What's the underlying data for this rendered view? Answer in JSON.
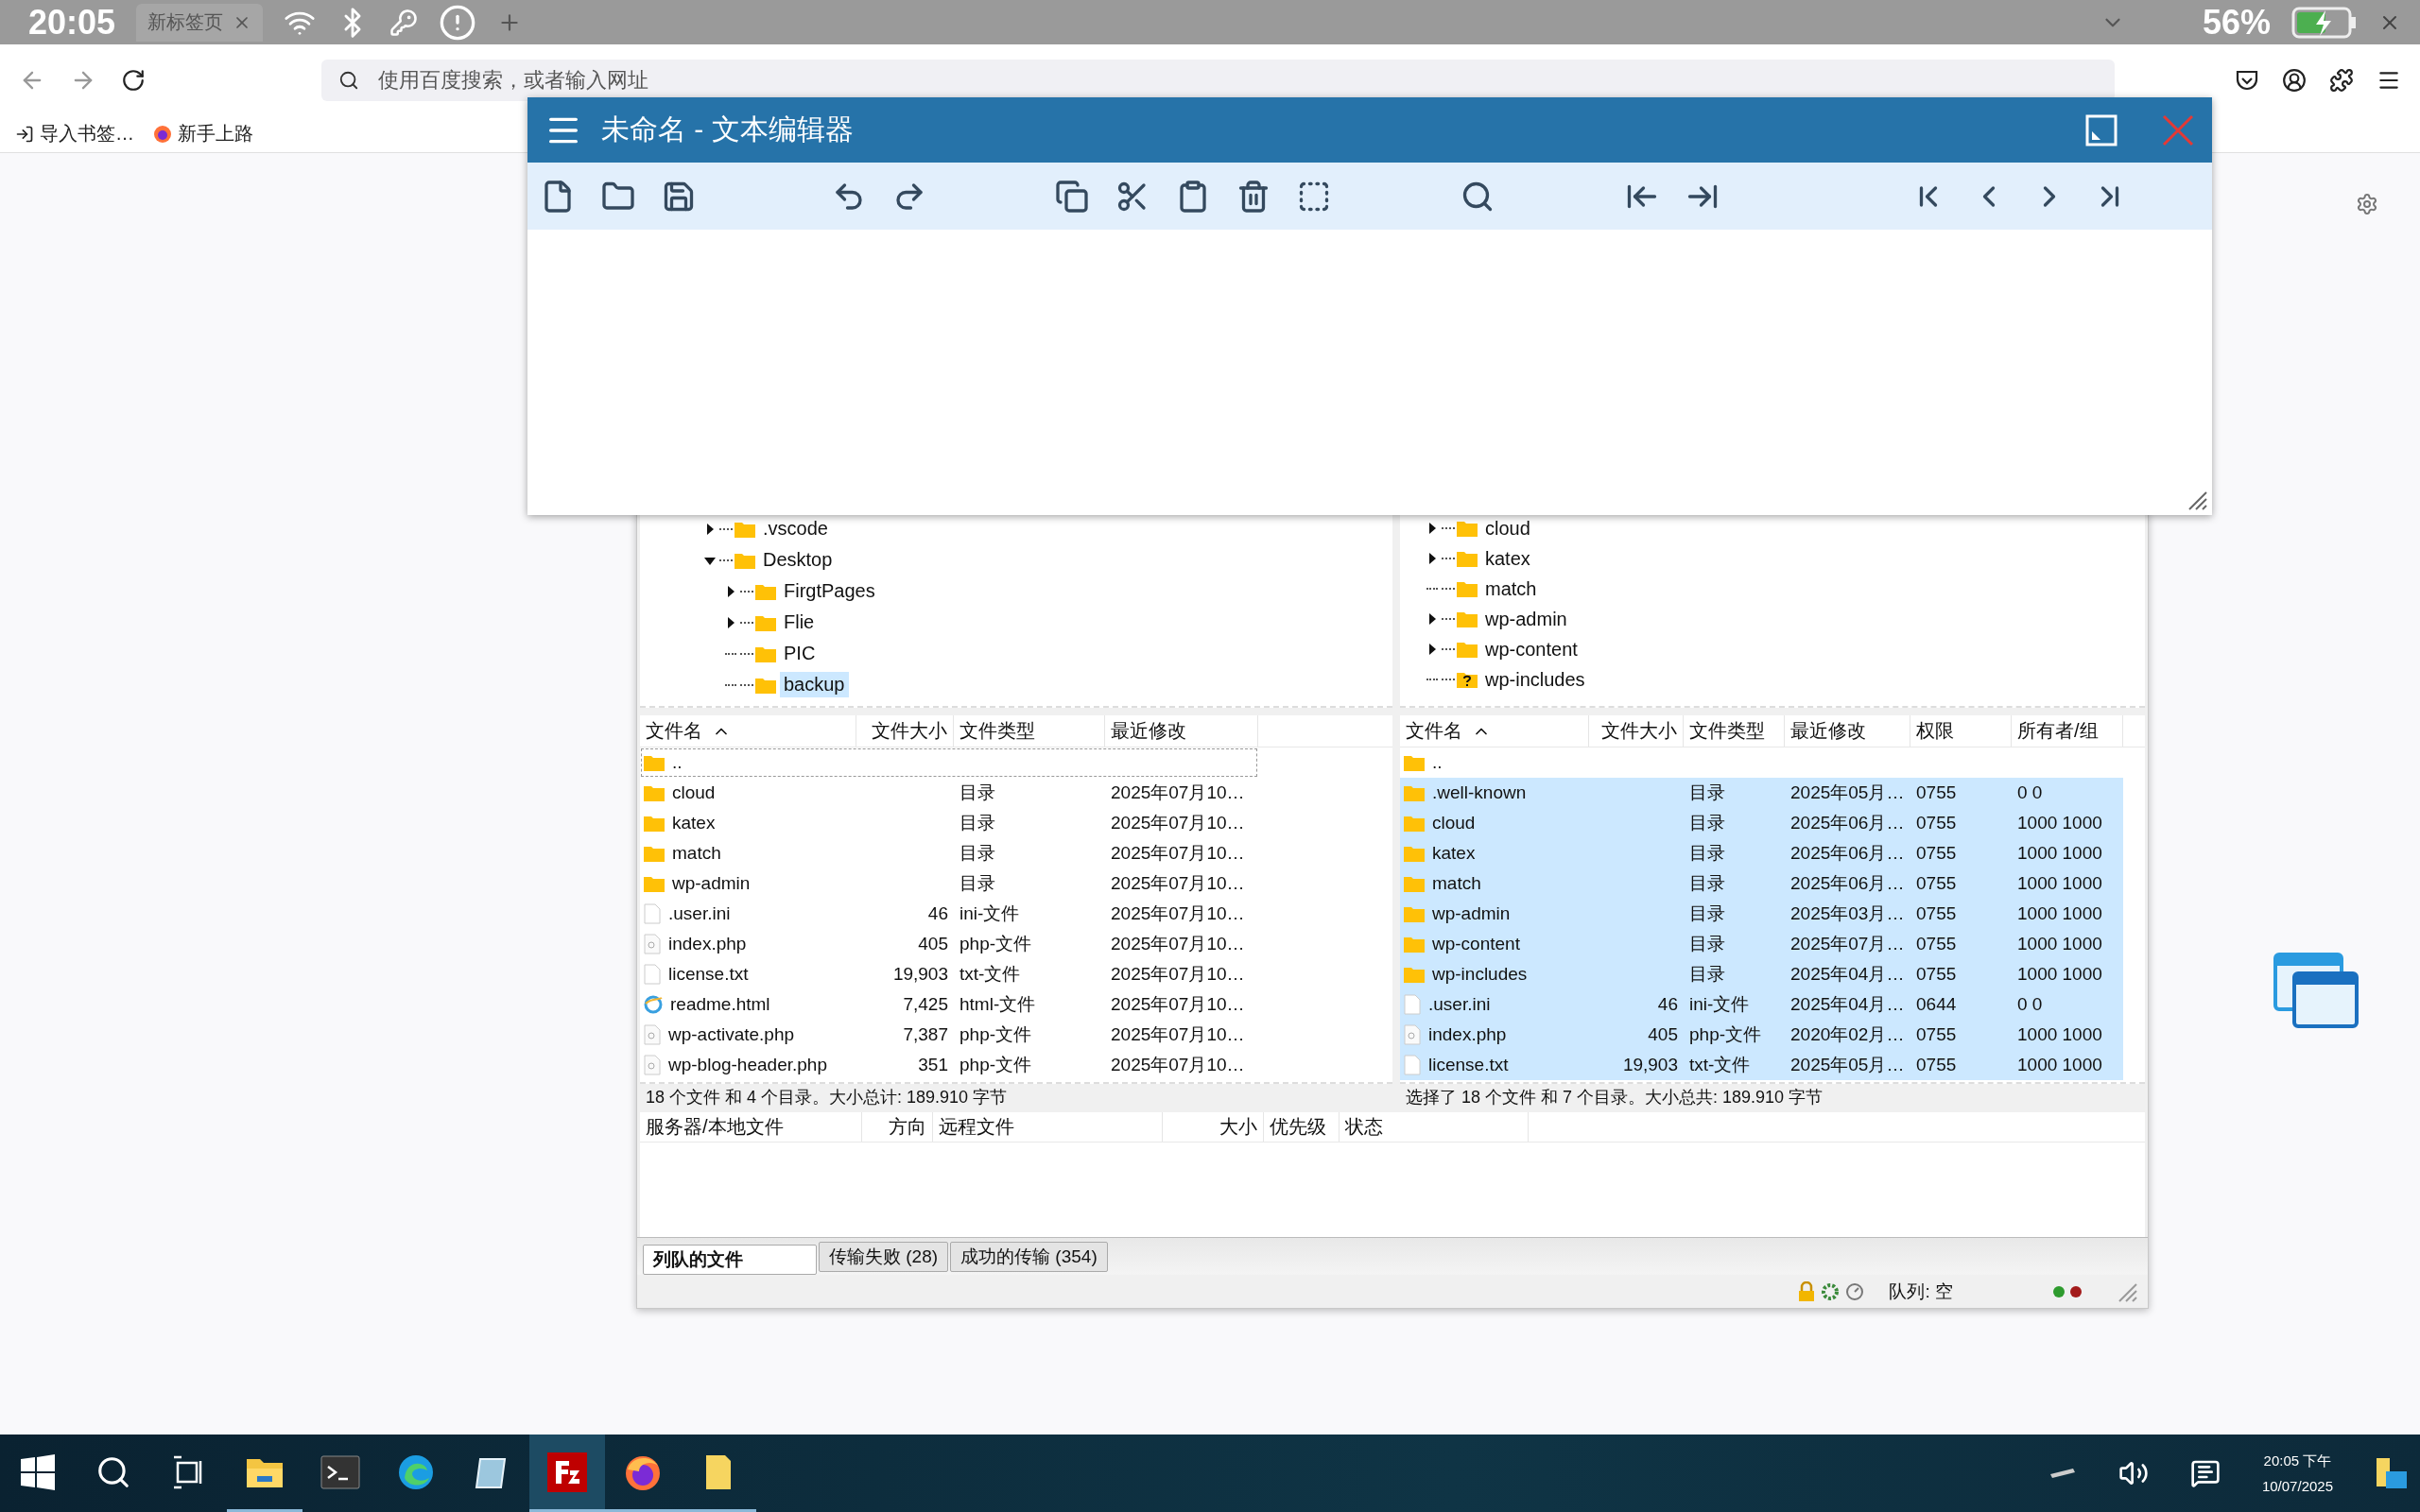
{
  "system_bar": {
    "time": "20:05",
    "battery": "56%"
  },
  "browser": {
    "tab": {
      "title": "新标签页"
    },
    "address": {
      "placeholder": "使用百度搜索，或者输入网址"
    },
    "bookmarks": [
      {
        "kind": "import",
        "label": "导入书签…"
      },
      {
        "kind": "firefox",
        "label": "新手上路"
      }
    ]
  },
  "editor": {
    "title": "未命名 - 文本编辑器"
  },
  "filezilla": {
    "local_tree": [
      {
        "label": ".vscode",
        "kind": "branch",
        "expanded": false,
        "selected": false
      },
      {
        "label": "Desktop",
        "kind": "branch",
        "expanded": true,
        "selected": false,
        "children": [
          {
            "label": "FirgtPages",
            "kind": "branch",
            "expanded": false,
            "selected": false
          },
          {
            "label": "Flie",
            "kind": "branch",
            "expanded": false,
            "selected": false
          },
          {
            "label": "PIC",
            "kind": "leaf",
            "selected": false
          },
          {
            "label": "backup",
            "kind": "leaf",
            "selected": true
          }
        ]
      }
    ],
    "remote_tree": [
      {
        "label": "cloud",
        "kind": "branch",
        "expanded": false,
        "selected": false
      },
      {
        "label": "katex",
        "kind": "branch",
        "expanded": false,
        "selected": false
      },
      {
        "label": "match",
        "kind": "leaf",
        "selected": false
      },
      {
        "label": "wp-admin",
        "kind": "branch",
        "expanded": false,
        "selected": false
      },
      {
        "label": "wp-content",
        "kind": "branch",
        "expanded": false,
        "selected": false
      },
      {
        "label": "wp-includes",
        "kind": "unknown",
        "selected": false
      }
    ],
    "local_list": {
      "columns": [
        {
          "label": "文件名",
          "sorted": true
        },
        {
          "label": "文件大小",
          "sorted": false
        },
        {
          "label": "文件类型",
          "sorted": false
        },
        {
          "label": "最近修改",
          "sorted": false
        }
      ],
      "rows": [
        {
          "kind": "folder",
          "name": "..",
          "selected": false,
          "focused": true
        },
        {
          "kind": "folder",
          "name": "cloud",
          "type": "目录",
          "modified": "2025年07月10…",
          "selected": false,
          "focused": false
        },
        {
          "kind": "folder",
          "name": "katex",
          "type": "目录",
          "modified": "2025年07月10…",
          "selected": false,
          "focused": false
        },
        {
          "kind": "folder",
          "name": "match",
          "type": "目录",
          "modified": "2025年07月10…",
          "selected": false,
          "focused": false
        },
        {
          "kind": "folder",
          "name": "wp-admin",
          "type": "目录",
          "modified": "2025年07月10…",
          "selected": false,
          "focused": false
        },
        {
          "kind": "file",
          "name": ".user.ini",
          "size": "46",
          "type": "ini-文件",
          "modified": "2025年07月10…",
          "selected": false,
          "focused": false
        },
        {
          "kind": "script",
          "name": "index.php",
          "size": "405",
          "type": "php-文件",
          "modified": "2025年07月10…",
          "selected": false,
          "focused": false
        },
        {
          "kind": "file",
          "name": "license.txt",
          "size": "19,903",
          "type": "txt-文件",
          "modified": "2025年07月10…",
          "selected": false,
          "focused": false
        },
        {
          "kind": "web",
          "name": "readme.html",
          "size": "7,425",
          "type": "html-文件",
          "modified": "2025年07月10…",
          "selected": false,
          "focused": false
        },
        {
          "kind": "script",
          "name": "wp-activate.php",
          "size": "7,387",
          "type": "php-文件",
          "modified": "2025年07月10…",
          "selected": false,
          "focused": false
        },
        {
          "kind": "script",
          "name": "wp-blog-header.php",
          "size": "351",
          "type": "php-文件",
          "modified": "2025年07月10…",
          "selected": false,
          "focused": false
        }
      ],
      "summary": "18 个文件 和 4 个目录。大小总计: 189.910 字节"
    },
    "remote_list": {
      "columns": [
        {
          "label": "文件名",
          "sorted": true
        },
        {
          "label": "文件大小",
          "sorted": false
        },
        {
          "label": "文件类型",
          "sorted": false
        },
        {
          "label": "最近修改",
          "sorted": false
        },
        {
          "label": "权限",
          "sorted": false
        },
        {
          "label": "所有者/组",
          "sorted": false
        }
      ],
      "rows": [
        {
          "kind": "folder",
          "name": "..",
          "selected": false,
          "focused": false
        },
        {
          "kind": "folder",
          "name": ".well-known",
          "type": "目录",
          "modified": "2025年05月…",
          "permissions": "0755",
          "owner": "0 0",
          "selected": true,
          "focused": false
        },
        {
          "kind": "folder",
          "name": "cloud",
          "type": "目录",
          "modified": "2025年06月…",
          "permissions": "0755",
          "owner": "1000 1000",
          "selected": true,
          "focused": false
        },
        {
          "kind": "folder",
          "name": "katex",
          "type": "目录",
          "modified": "2025年06月…",
          "permissions": "0755",
          "owner": "1000 1000",
          "selected": true,
          "focused": false
        },
        {
          "kind": "folder",
          "name": "match",
          "type": "目录",
          "modified": "2025年06月…",
          "permissions": "0755",
          "owner": "1000 1000",
          "selected": true,
          "focused": false
        },
        {
          "kind": "folder",
          "name": "wp-admin",
          "type": "目录",
          "modified": "2025年03月…",
          "permissions": "0755",
          "owner": "1000 1000",
          "selected": true,
          "focused": false
        },
        {
          "kind": "folder",
          "name": "wp-content",
          "type": "目录",
          "modified": "2025年07月…",
          "permissions": "0755",
          "owner": "1000 1000",
          "selected": true,
          "focused": false
        },
        {
          "kind": "folder",
          "name": "wp-includes",
          "type": "目录",
          "modified": "2025年04月…",
          "permissions": "0755",
          "owner": "1000 1000",
          "selected": true,
          "focused": false
        },
        {
          "kind": "file",
          "name": ".user.ini",
          "size": "46",
          "type": "ini-文件",
          "modified": "2025年04月…",
          "permissions": "0644",
          "owner": "0 0",
          "selected": true,
          "focused": false
        },
        {
          "kind": "script",
          "name": "index.php",
          "size": "405",
          "type": "php-文件",
          "modified": "2020年02月…",
          "permissions": "0755",
          "owner": "1000 1000",
          "selected": true,
          "focused": false
        },
        {
          "kind": "file",
          "name": "license.txt",
          "size": "19,903",
          "type": "txt-文件",
          "modified": "2025年05月…",
          "permissions": "0755",
          "owner": "1000 1000",
          "selected": true,
          "focused": false
        }
      ],
      "summary": "选择了 18 个文件 和 7 个目录。大小总共: 189.910 字节"
    },
    "queue": {
      "columns": [
        "服务器/本地文件",
        "方向",
        "远程文件",
        "大小",
        "优先级",
        "状态"
      ]
    },
    "queue_tabs": [
      {
        "label": "列队的文件",
        "selected": true
      },
      {
        "label": "传输失败 (28)",
        "selected": false
      },
      {
        "label": "成功的传输 (354)",
        "selected": false
      }
    ],
    "status": {
      "queue": "队列: 空",
      "lights": [
        {
          "color": "#2e9b2e"
        },
        {
          "color": "#a31b1b"
        }
      ]
    }
  },
  "taskbar": {
    "apps": [
      {
        "kind": "start",
        "running": false,
        "selected": false
      },
      {
        "kind": "search",
        "running": false,
        "selected": false
      },
      {
        "kind": "taskview",
        "running": false,
        "selected": false
      },
      {
        "kind": "explorer",
        "running": true,
        "selected": false
      },
      {
        "kind": "terminal",
        "running": false,
        "selected": false
      },
      {
        "kind": "edge",
        "running": false,
        "selected": false
      },
      {
        "kind": "glass",
        "running": false,
        "selected": false
      },
      {
        "kind": "filezilla",
        "running": true,
        "selected": true
      },
      {
        "kind": "firefox",
        "running": true,
        "selected": false
      },
      {
        "kind": "note",
        "running": true,
        "selected": false
      }
    ],
    "time": "20:05 下午",
    "date": "10/07/2025"
  }
}
